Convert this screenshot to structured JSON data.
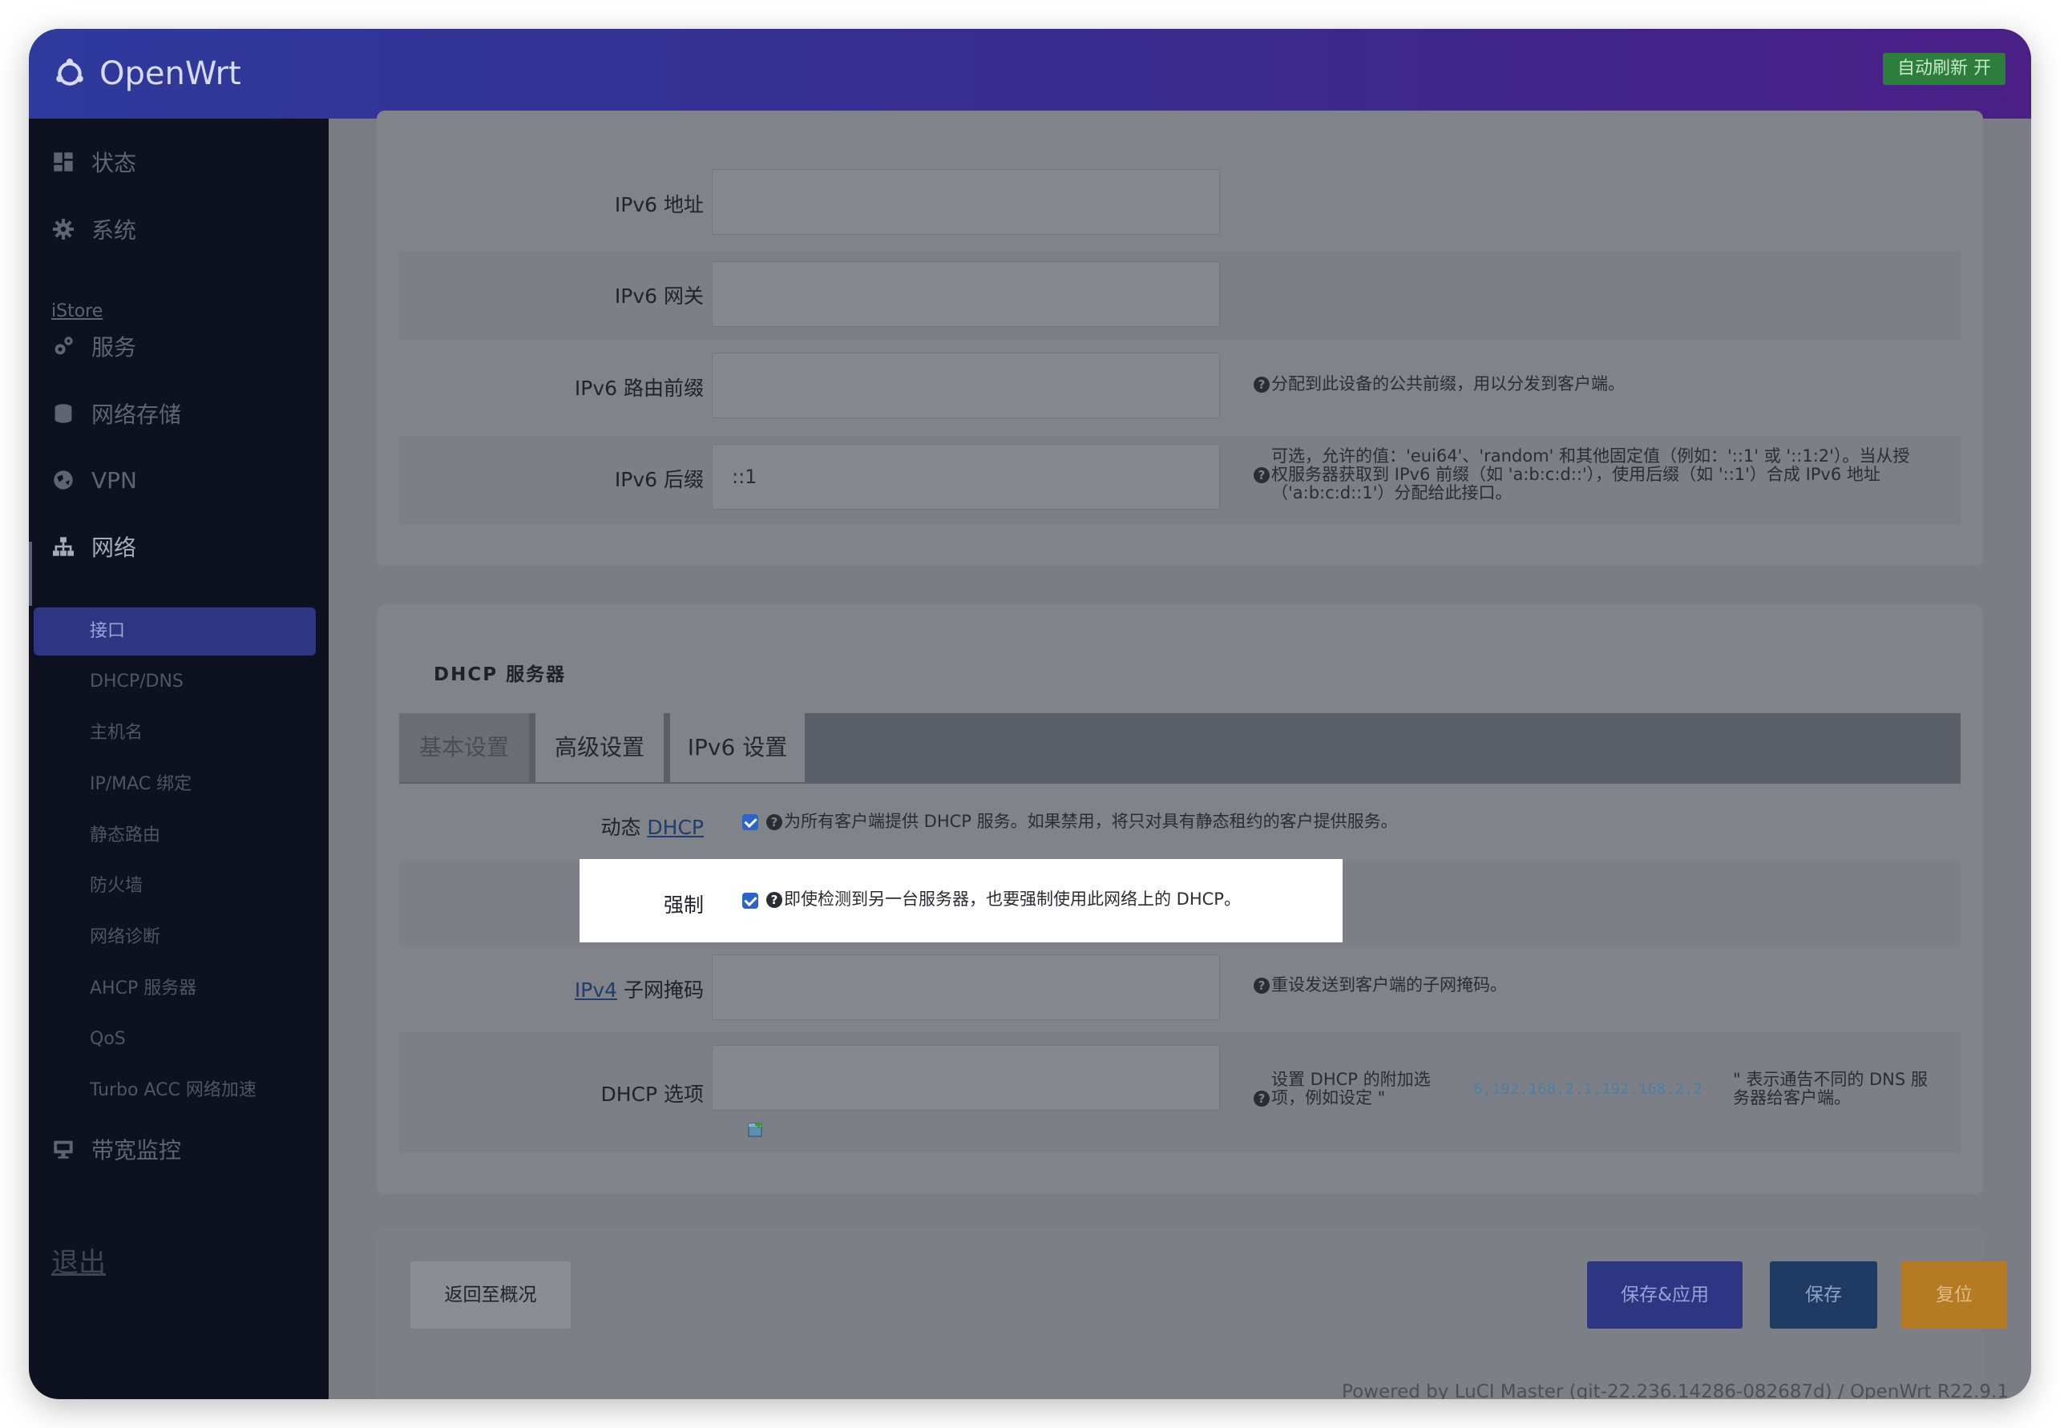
{
  "header": {
    "brand": "OpenWrt",
    "auto_refresh": "自动刷新 开"
  },
  "sidebar": {
    "top_items": [
      {
        "label": "状态",
        "icon": "dashboard-icon"
      },
      {
        "label": "系统",
        "icon": "gear-icon"
      },
      {
        "label": "服务",
        "icon": "gears-icon"
      },
      {
        "label": "网络存储",
        "icon": "database-icon"
      },
      {
        "label": "VPN",
        "icon": "globe-icon"
      },
      {
        "label": "网络",
        "icon": "network-icon"
      },
      {
        "label": "带宽监控",
        "icon": "monitor-icon"
      }
    ],
    "istore": "iStore",
    "network_sub": [
      "接口",
      "DHCP/DNS",
      "主机名",
      "IP/MAC 绑定",
      "静态路由",
      "防火墙",
      "网络诊断",
      "AHCP 服务器",
      "QoS",
      "Turbo ACC 网络加速"
    ],
    "logout": "退出"
  },
  "ipv6_section": {
    "ipv6_address_label": "IPv6 地址",
    "ipv6_gateway_label": "IPv6 网关",
    "ipv6_prefix_label": "IPv6 路由前缀",
    "ipv6_prefix_help": "分配到此设备的公共前缀，用以分发到客户端。",
    "ipv6_suffix_label": "IPv6 后缀",
    "ipv6_suffix_value": "::1",
    "ipv6_suffix_help_1": "可选，允许的值：'eui64'、'random' 和其他固定值（例如：'::1' 或 '::1:2'）。当从授",
    "ipv6_suffix_help_2": "权服务器获取到 IPv6 前缀（如 'a:b:c:d::'），使用后缀（如 '::1'）合成 IPv6 地址",
    "ipv6_suffix_help_3": "（'a:b:c:d::1'）分配给此接口。"
  },
  "dhcp_section": {
    "title": "DHCP 服务器",
    "tabs": [
      "基本设置",
      "高级设置",
      "IPv6 设置"
    ],
    "dynamic_label": "动态",
    "dynamic_link": "DHCP",
    "dynamic_help": "为所有客户端提供 DHCP 服务。如果禁用，将只对具有静态租约的客户提供服务。",
    "force_label": "强制",
    "force_help": "即使检测到另一台服务器，也要强制使用此网络上的 DHCP。",
    "netmask_link": "IPv4",
    "netmask_label": "子网掩码",
    "netmask_help": "重设发送到客户端的子网掩码。",
    "options_label": "DHCP 选项",
    "options_help_1": "设置 DHCP 的附加选",
    "options_help_2": "项，例如设定 \"",
    "options_code": "6,192.168.2.1,192.168.2.2",
    "options_help_3": "\" 表示通告不同的 DNS 服",
    "options_help_4": "务器给客户端。"
  },
  "actions": {
    "back": "返回至概况",
    "save_apply": "保存&应用",
    "save": "保存",
    "reset": "复位"
  },
  "footer": "Powered by LuCI Master (git-22.236.14286-082687d) / OpenWrt R22.9.1",
  "colors": {
    "header_start": "#2e3a9c",
    "header_end": "#4a1f86",
    "auto_refresh_bg": "#2d7e3c",
    "save_apply_bg": "#2e3583",
    "save_bg": "#1f3a63",
    "reset_bg": "#b57a24"
  }
}
